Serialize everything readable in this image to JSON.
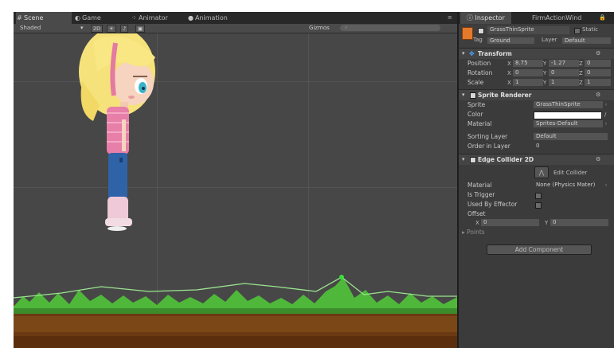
{
  "scene_tabs": {
    "scene": "Scene",
    "game": "Game",
    "animator": "Animator",
    "animation": "Animation"
  },
  "scene_toolbar": {
    "shading": "Shaded",
    "mode_2d": "2D",
    "gizmos": "Gizmos"
  },
  "inspector_tabs": {
    "inspector": "Inspector",
    "other": "FirmActionWind"
  },
  "object": {
    "enabled": true,
    "name": "GrassThinSprite",
    "static_label": "Static",
    "tag_label": "Tag",
    "tag_value": "Ground",
    "layer_label": "Layer",
    "layer_value": "Default"
  },
  "transform": {
    "title": "Transform",
    "position_label": "Position",
    "rotation_label": "Rotation",
    "scale_label": "Scale",
    "position": {
      "x": "8.75",
      "y": "-1.27",
      "z": "0"
    },
    "rotation": {
      "x": "0",
      "y": "0",
      "z": "0"
    },
    "scale": {
      "x": "1",
      "y": "1",
      "z": "1"
    }
  },
  "sprite_renderer": {
    "title": "Sprite Renderer",
    "sprite_label": "Sprite",
    "sprite_value": "GrassThinSprite",
    "color_label": "Color",
    "color_value": "#ffffff",
    "material_label": "Material",
    "material_value": "Sprites-Default",
    "sorting_layer_label": "Sorting Layer",
    "sorting_layer_value": "Default",
    "order_label": "Order in Layer",
    "order_value": "0"
  },
  "edge_collider": {
    "title": "Edge Collider 2D",
    "edit_label": "Edit Collider",
    "material_label": "Material",
    "material_value": "None (Physics Mater)",
    "is_trigger_label": "Is Trigger",
    "used_by_effector_label": "Used By Effector",
    "offset_label": "Offset",
    "offset_x": "0",
    "offset_y": "0",
    "points_label": "Points"
  },
  "add_component": "Add Component",
  "colors": {
    "grass": "#4fb83a",
    "collider": "#9be58f",
    "dirt": "#6b3a12",
    "shirt": "#e77fa8",
    "hair": "#f6e27a"
  }
}
